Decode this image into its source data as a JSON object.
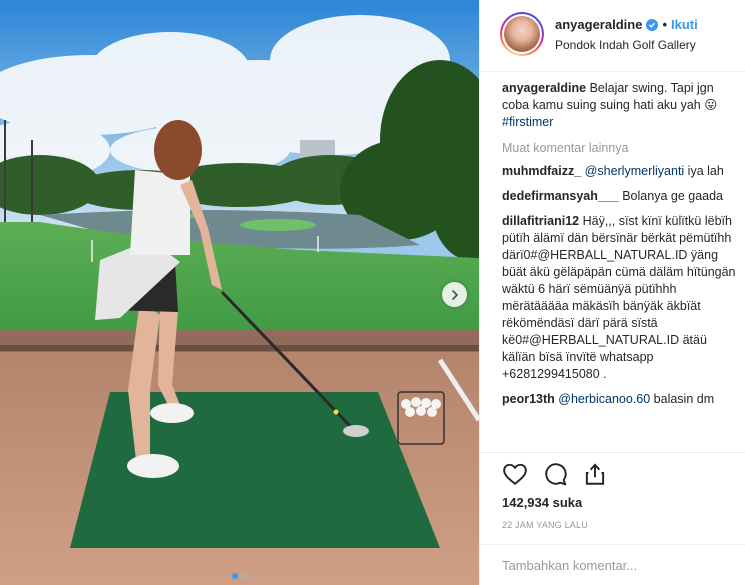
{
  "post": {
    "username": "anyageraldine",
    "follow_separator": "•",
    "follow_label": "Ikuti",
    "location": "Pondok Indah Golf Gallery",
    "photo_description": "golf-driving-range-photo"
  },
  "caption": {
    "username": "anyageraldine",
    "text": "Belajar swing. Tapi jgn coba kamu suing suing hati aku yah",
    "emoji": "😛",
    "hashtag": "#firstimer"
  },
  "load_more_label": "Muat komentar lainnya",
  "comments": [
    {
      "username": "muhmdfaizz_",
      "mention": "@sherlymerliyanti",
      "text": " iya lah"
    },
    {
      "username": "dedefirmansyah___",
      "mention": "",
      "text": "Bolanya ge gaada"
    },
    {
      "username": "dillafitriani12",
      "mention": "",
      "text": "Häÿ,,, sïst kïnï külïtkü lëbïh pütïh älämï dän bërsïnär bërkät pëmütïhh därï0#@HERBALL_NATURAL.ID ÿäng büät äkü gëläpäpän cümä däläm hïtüngän wäktü 6 härï sëmüänÿä pütïhhh mërätääääa mäkäsïh bänÿäk äkbïät rëkömëndäsï därï pärä sïstä kë0#@HERBALL_NATURAL.ID ätäü kälïän bïsä ïnvïtë whatsapp +6281299415080 ."
    },
    {
      "username": "peor13th",
      "mention": "@herbicanoo.60",
      "text": " balasin dm"
    }
  ],
  "likes_label": "142,934 suka",
  "timestamp": "22 JAM YANG LALU",
  "add_comment_placeholder": "Tambahkan komentar...",
  "icons": {
    "like": "heart-icon",
    "comment": "comment-icon",
    "share": "share-icon",
    "verified": "verified-badge-icon",
    "next": "chevron-right-icon"
  },
  "carousel": {
    "total": 2,
    "current": 1
  },
  "colors": {
    "accent": "#3897f0",
    "text": "#262626",
    "muted": "#999999",
    "link": "#003569"
  }
}
